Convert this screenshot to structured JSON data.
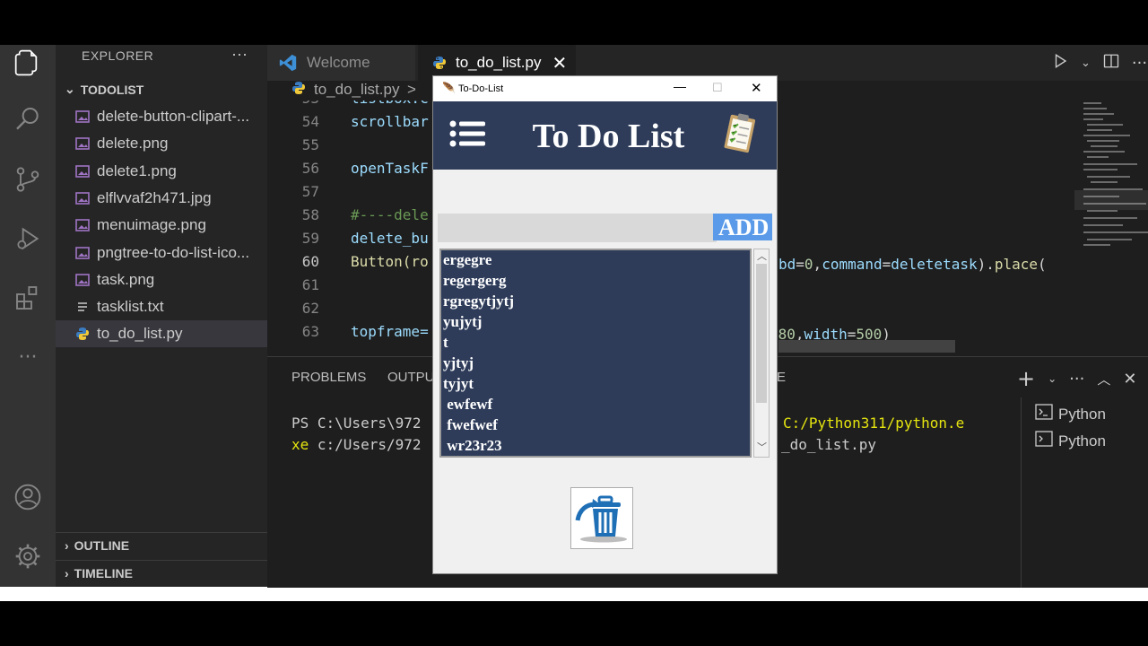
{
  "explorer": {
    "title": "EXPLORER",
    "folder": "TODOLIST",
    "files": [
      {
        "name": "delete-button-clipart-...",
        "icon": "image-file-icon"
      },
      {
        "name": "delete.png",
        "icon": "image-file-icon"
      },
      {
        "name": "delete1.png",
        "icon": "image-file-icon"
      },
      {
        "name": "elflvvaf2h471.jpg",
        "icon": "image-file-icon"
      },
      {
        "name": "menuimage.png",
        "icon": "image-file-icon"
      },
      {
        "name": "pngtree-to-do-list-ico...",
        "icon": "image-file-icon"
      },
      {
        "name": "task.png",
        "icon": "image-file-icon"
      },
      {
        "name": "tasklist.txt",
        "icon": "text-file-icon"
      },
      {
        "name": "to_do_list.py",
        "icon": "python-file-icon"
      }
    ],
    "outline": "OUTLINE",
    "timeline": "TIMELINE"
  },
  "tabs": {
    "welcome": "Welcome",
    "file": "to_do_list.py"
  },
  "breadcrumb": {
    "file": "to_do_list.py",
    "sep": ">"
  },
  "editor": {
    "lines": [
      {
        "num": "54",
        "code": "scrollbar"
      },
      {
        "num": "55",
        "code": ""
      },
      {
        "num": "56",
        "code": "openTaskF"
      },
      {
        "num": "57",
        "code": ""
      },
      {
        "num": "58",
        "code": "#----dele"
      },
      {
        "num": "59",
        "code": "delete_bu"
      },
      {
        "num": "60",
        "code": "Button(ro"
      },
      {
        "num": "61",
        "code": ""
      },
      {
        "num": "62",
        "code": ""
      },
      {
        "num": "63",
        "code": "topframe="
      }
    ],
    "line60_tail": "bd=0,command=deletetask).place(",
    "line63_tail": "=80,width=500)"
  },
  "panel": {
    "problems": "PROBLEMS",
    "output": "OUTPUT",
    "partial_tab": "E",
    "term_line1_a": "PS C:\\Users\\972",
    "term_line1_b": "C:/Python311/python.e",
    "term_line2_a": "xe c:/Users/972",
    "term_line2_b": "_do_list.py",
    "terminals": [
      "Python",
      "Python"
    ]
  },
  "tkapp": {
    "window_title": "To-Do-List",
    "header_title": "To Do List",
    "add_label": "ADD",
    "entry_value": "",
    "tasks": [
      "ergegre",
      "regergerg",
      "rgregytjytj",
      "yujytj",
      "t",
      "yjtyj",
      "tyjyt",
      " ewfewf",
      " fwefwef",
      " wr23r23"
    ]
  },
  "colors": {
    "tk_header": "#2e3c5a",
    "tk_add": "#5a9ae8",
    "editor_bg": "#1e1e1e",
    "sidebar_bg": "#252526"
  }
}
